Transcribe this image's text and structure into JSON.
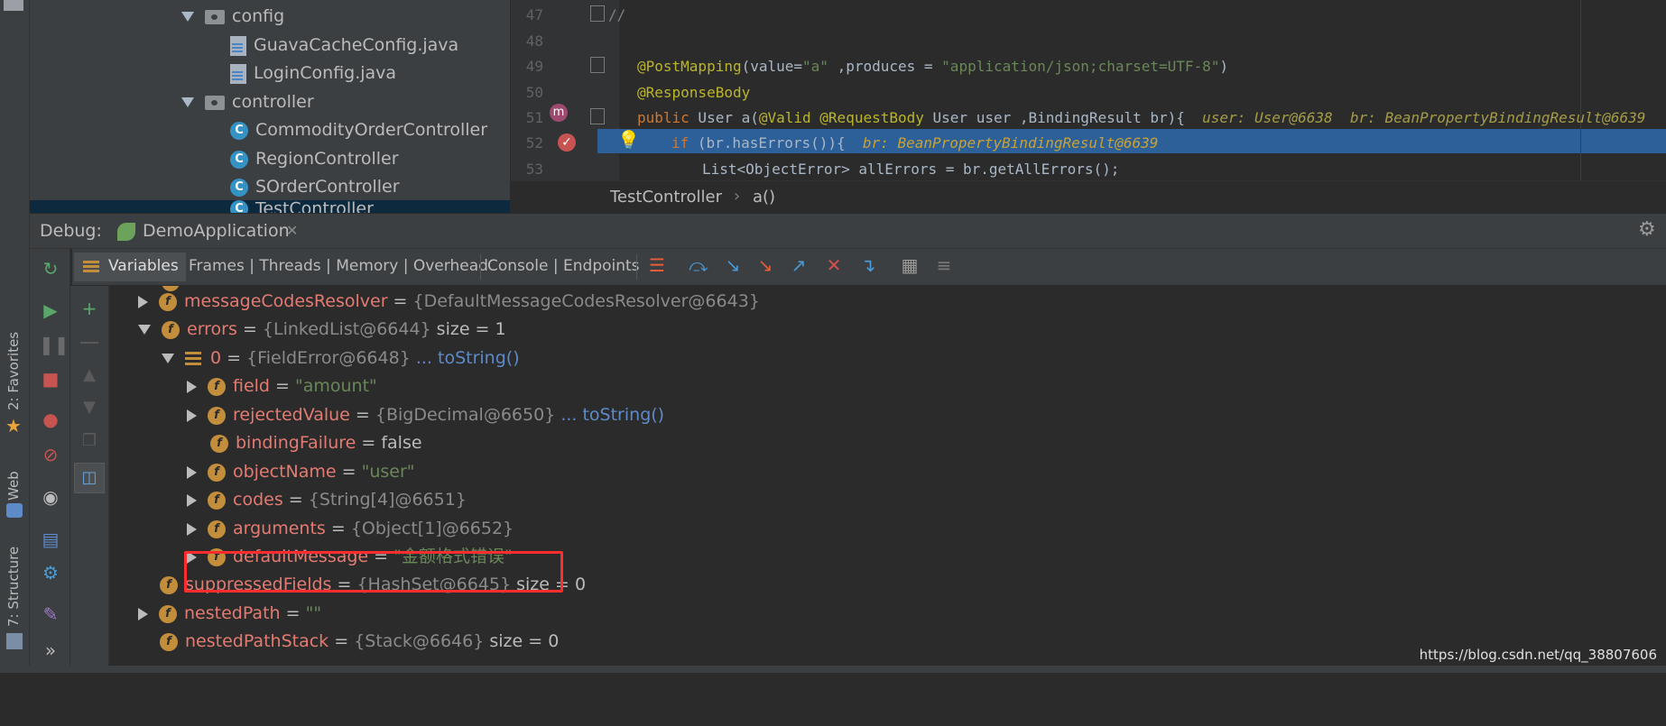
{
  "colors": {
    "accent": "#2d6099",
    "highlight_box": "#ff2d2d",
    "field_icon": "#c38e3b",
    "class_icon": "#3592c4"
  },
  "left_strip": {
    "tabs": [
      "2: Favorites",
      "Web",
      "7: Structure"
    ]
  },
  "project_tree": {
    "items": [
      {
        "label": "config",
        "kind": "folder"
      },
      {
        "label": "GuavaCacheConfig.java",
        "kind": "file"
      },
      {
        "label": "LoginConfig.java",
        "kind": "file"
      },
      {
        "label": "controller",
        "kind": "folder"
      },
      {
        "label": "CommodityOrderController",
        "kind": "class"
      },
      {
        "label": "RegionController",
        "kind": "class"
      },
      {
        "label": "SOrderController",
        "kind": "class"
      },
      {
        "label": "TestController",
        "kind": "class"
      }
    ]
  },
  "editor": {
    "line_numbers": [
      "47",
      "48",
      "49",
      "50",
      "51",
      "52",
      "53"
    ],
    "lines": {
      "l47": "//",
      "l49_anno": "@PostMapping",
      "l49_a": "(value=",
      "l49_s1": "\"a\"",
      "l49_b": " ,produces = ",
      "l49_s2": "\"application/json;charset=UTF-8\"",
      "l49_c": ")",
      "l50": "@ResponseBody",
      "l51_kw": "public",
      "l51_a": " User a(",
      "l51_anno": "@Valid @RequestBody",
      "l51_b": " User user ,BindingResult br){",
      "l51_hint1": "user: User@6638",
      "l51_hint2": "br: BeanPropertyBindingResult@6639",
      "l52_kw": "if",
      "l52_a": " (br.hasErrors()){",
      "l52_hint": "br: BeanPropertyBindingResult@6639",
      "l53": "List<ObjectError> allErrors = br.getAllErrors();"
    },
    "breadcrumb": {
      "class": "TestController",
      "method": "a()"
    }
  },
  "debug": {
    "label": "Debug:",
    "config": "DemoApplication",
    "tabs": {
      "variables": "Variables",
      "frames": "Frames | Threads | Memory | Overhead",
      "console": "Console | Endpoints"
    }
  },
  "variables": [
    {
      "name": "messageCodesResolver",
      "eq": " = ",
      "value": "{DefaultMessageCodesResolver@6643}",
      "extra": ""
    },
    {
      "name": "errors",
      "eq": " = ",
      "value": "{LinkedList@6644}",
      "extra": " size = 1"
    },
    {
      "name": "0",
      "eq": " = ",
      "value": "{FieldError@6648}",
      "extra": "... toString()"
    },
    {
      "name": "field",
      "eq": " = ",
      "value": "\"amount\"",
      "extra": ""
    },
    {
      "name": "rejectedValue",
      "eq": " = ",
      "value": "{BigDecimal@6650}",
      "extra": "... toString()"
    },
    {
      "name": "bindingFailure",
      "eq": " = ",
      "value": "false",
      "extra": ""
    },
    {
      "name": "objectName",
      "eq": " = ",
      "value": "\"user\"",
      "extra": ""
    },
    {
      "name": "codes",
      "eq": " = ",
      "value": "{String[4]@6651}",
      "extra": ""
    },
    {
      "name": "arguments",
      "eq": " = ",
      "value": "{Object[1]@6652}",
      "extra": ""
    },
    {
      "name": "defaultMessage",
      "eq": " = ",
      "value": "\"金额格式错误\"",
      "extra": ""
    },
    {
      "name": "suppressedFields",
      "eq": " = ",
      "value": "{HashSet@6645}",
      "extra": " size = 0"
    },
    {
      "name": "nestedPath",
      "eq": " = ",
      "value": "\"\"",
      "extra": ""
    },
    {
      "name": "nestedPathStack",
      "eq": " = ",
      "value": "{Stack@6646}",
      "extra": " size = 0"
    }
  ],
  "watermark": "https://blog.csdn.net/qq_38807606"
}
